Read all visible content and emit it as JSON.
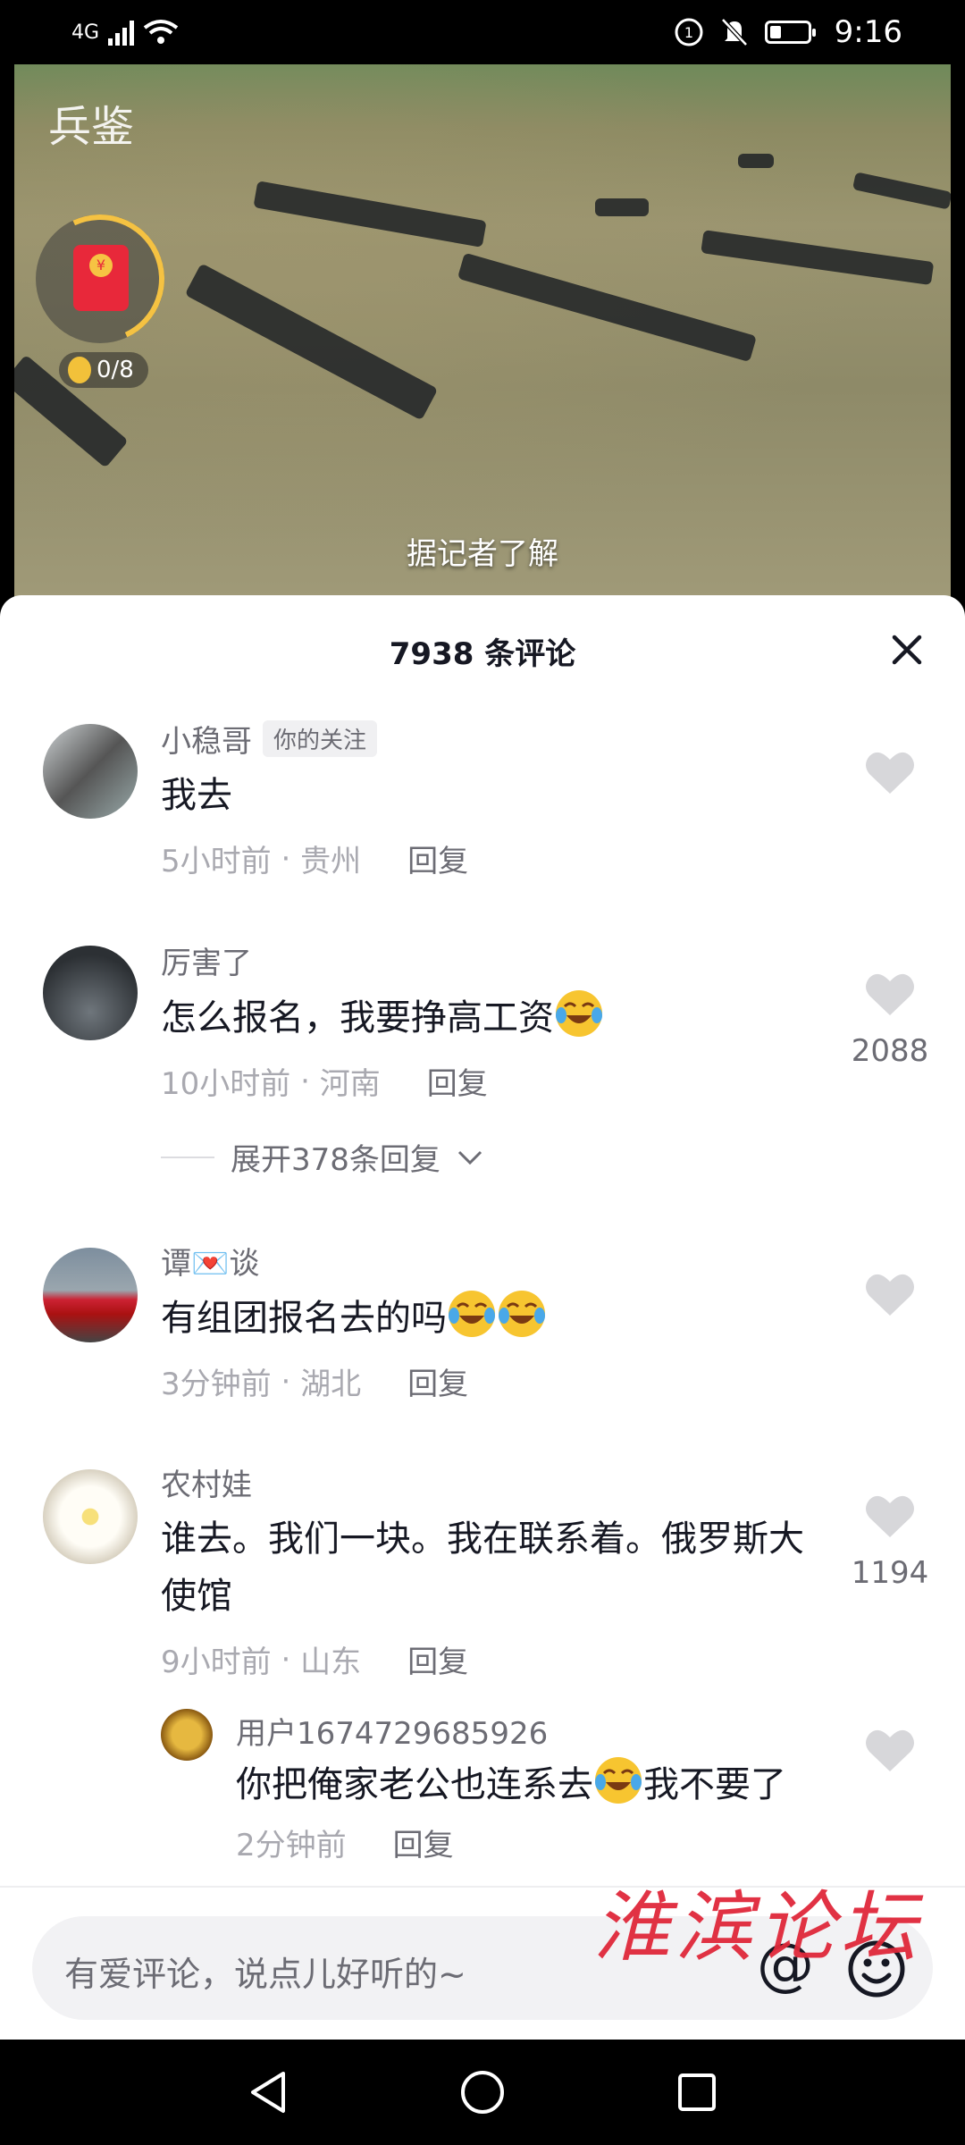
{
  "status_bar": {
    "network": "4G",
    "time": "9:16"
  },
  "video": {
    "logo_text": "兵鉴",
    "coin_counter": "0/8",
    "subtitle": "据记者了解"
  },
  "comments_panel": {
    "title": "7938 条评论",
    "comments": [
      {
        "username": "小稳哥",
        "badge": "你的关注",
        "text": "我去",
        "time": "5小时前",
        "location": "贵州",
        "reply_label": "回复",
        "likes": ""
      },
      {
        "username": "厉害了",
        "text": "怎么报名，我要挣高工资",
        "time": "10小时前",
        "location": "河南",
        "reply_label": "回复",
        "likes": "2088",
        "expand_label": "展开378条回复"
      },
      {
        "username": "谭💌谈",
        "text": "有组团报名去的吗",
        "time": "3分钟前",
        "location": "湖北",
        "reply_label": "回复",
        "likes": ""
      },
      {
        "username": "农村娃",
        "text": "谁去。我们一块。我在联系着。俄罗斯大使馆",
        "time": "9小时前",
        "location": "山东",
        "reply_label": "回复",
        "likes": "1194"
      }
    ],
    "reply": {
      "username": "用户1674729685926",
      "text_before": "你把俺家老公也连系去",
      "text_after": "我不要了",
      "time": "2分钟前",
      "reply_label": "回复"
    }
  },
  "input": {
    "placeholder": "有爱评论，说点儿好听的~",
    "at_symbol": "@"
  },
  "watermark": "淮滨论坛",
  "colors": {
    "accent_red": "#e8283a",
    "text_primary": "#161823",
    "text_secondary": "#6c6c74",
    "text_tertiary": "#a9a9b0"
  }
}
